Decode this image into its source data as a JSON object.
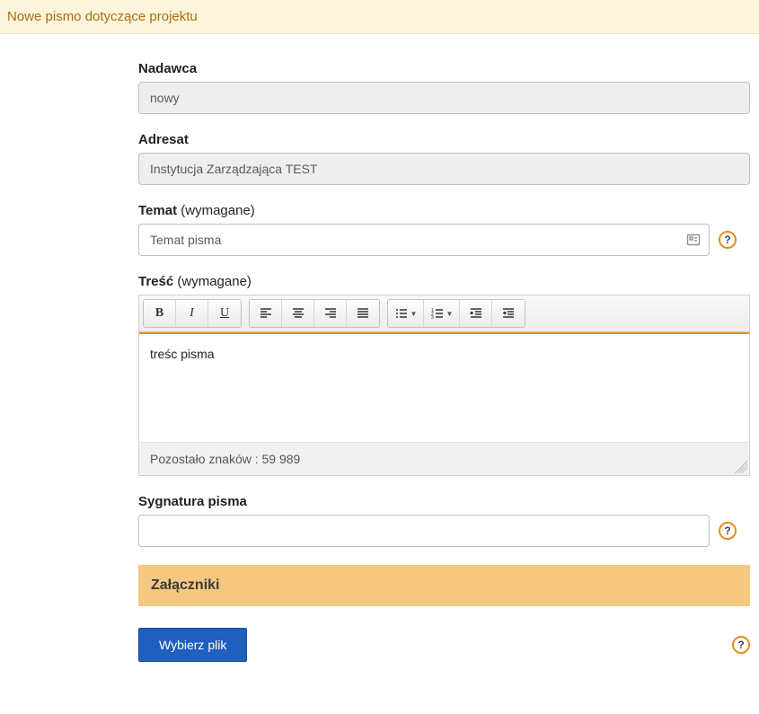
{
  "header": {
    "title": "Nowe pismo dotyczące projektu"
  },
  "form": {
    "nadawca": {
      "label": "Nadawca",
      "value": "nowy"
    },
    "adresat": {
      "label": "Adresat",
      "value": "Instytucja Zarządzająca TEST"
    },
    "temat": {
      "label": "Temat",
      "required_hint": " (wymagane)",
      "value": "Temat pisma"
    },
    "tresc": {
      "label": "Treść",
      "required_hint": " (wymagane)",
      "value": "treśc pisma",
      "counter": "Pozostało znaków : 59 989"
    },
    "sygnatura": {
      "label": "Sygnatura pisma",
      "value": ""
    },
    "zalaczniki": {
      "heading": "Załączniki",
      "button": "Wybierz plik"
    },
    "help_glyph": "?"
  },
  "toolbar": {
    "bold": "B",
    "italic": "I",
    "underline": "U"
  }
}
